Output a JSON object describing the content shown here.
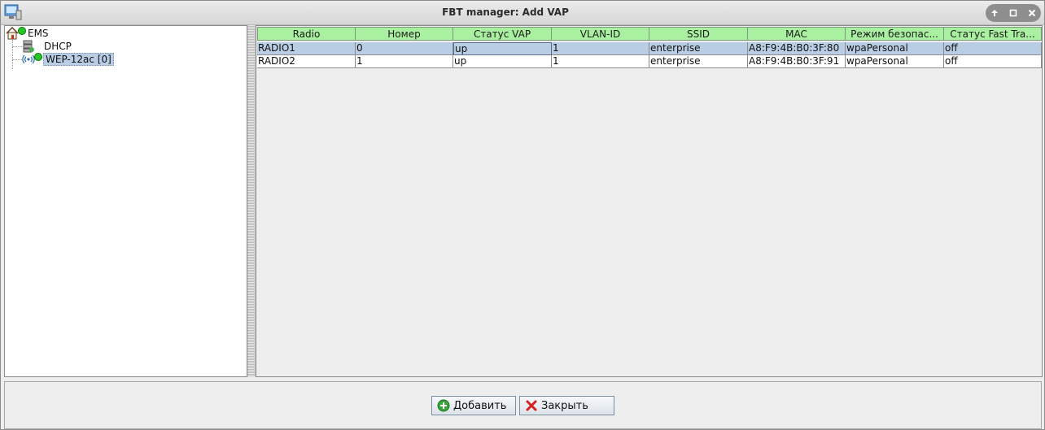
{
  "window": {
    "title": "FBT manager: Add VAP"
  },
  "tree": {
    "root": {
      "label": "EMS",
      "status_color": "#22c922"
    },
    "children": [
      {
        "label": "DHCP",
        "icon": "server-icon"
      },
      {
        "label": "WEP-12ac [0]",
        "icon": "wifi-ap-icon",
        "status_color": "#22c922",
        "selected": true
      }
    ]
  },
  "table": {
    "header_color": "#a9f0a0",
    "selected_row_color": "#b9cde5",
    "columns": [
      "Radio",
      "Номер",
      "Статус VAP",
      "VLAN-ID",
      "SSID",
      "MAC",
      "Режим безопас...",
      "Статус Fast Tra..."
    ],
    "rows": [
      [
        "RADIO1",
        "0",
        "up",
        "1",
        "enterprise",
        "A8:F9:4B:B0:3F:80",
        "wpaPersonal",
        "off"
      ],
      [
        "RADIO2",
        "1",
        "up",
        "1",
        "enterprise",
        "A8:F9:4B:B0:3F:91",
        "wpaPersonal",
        "off"
      ]
    ]
  },
  "buttons": {
    "add": "Добавить",
    "close": "Закрыть"
  }
}
